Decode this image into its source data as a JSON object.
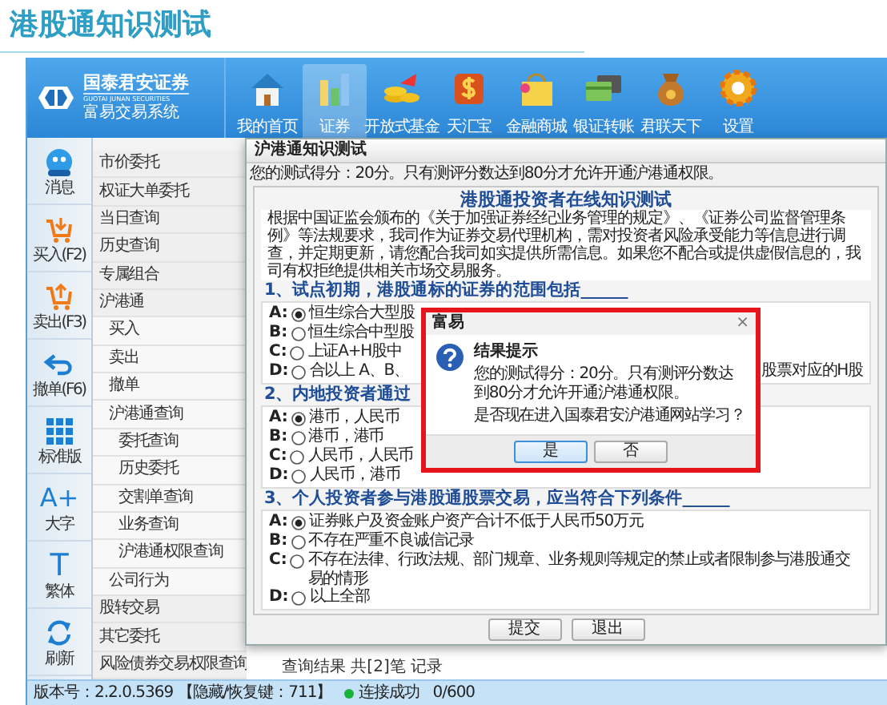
{
  "page_title": "港股通知识测试",
  "app": {
    "logo": {
      "name_cn": "国泰君安证券",
      "name_en": "GUOTAI JUNAN SECURITIES",
      "system": "富易交易系统"
    },
    "nav": [
      {
        "kind": "home",
        "label": "我的首页",
        "selected": false
      },
      {
        "kind": "bars",
        "label": "证券",
        "selected": true
      },
      {
        "kind": "coins",
        "label": "开放式基金",
        "selected": false
      },
      {
        "kind": "dollar",
        "label": "天汇宝",
        "selected": false
      },
      {
        "kind": "bag",
        "label": "金融商城",
        "selected": false
      },
      {
        "kind": "cards",
        "label": "银证转账",
        "selected": false
      },
      {
        "kind": "moneybag",
        "label": "君联天下",
        "selected": false
      },
      {
        "kind": "gear",
        "label": "设置",
        "selected": false
      }
    ]
  },
  "tools": [
    {
      "kind": "chat",
      "label": "消息"
    },
    {
      "kind": "buy",
      "label": "买入(F2)"
    },
    {
      "kind": "sell",
      "label": "卖出(F3)"
    },
    {
      "kind": "undo",
      "label": "撤单(F6)"
    },
    {
      "kind": "grid",
      "label": "标准版"
    },
    {
      "kind": "glyph",
      "glyph": "A+",
      "label": "大字"
    },
    {
      "kind": "glyph",
      "glyph": "T",
      "label": "繁体"
    },
    {
      "kind": "refresh",
      "label": "刷新"
    }
  ],
  "menu": [
    {
      "label": "市价委托"
    },
    {
      "label": "权证大单委托"
    },
    {
      "label": "当日查询"
    },
    {
      "label": "历史查询"
    },
    {
      "label": "专属组合"
    },
    {
      "label": "沪港通",
      "expanded": true,
      "children": [
        {
          "label": "买入"
        },
        {
          "label": "卖出"
        },
        {
          "label": "撤单"
        },
        {
          "label": "沪港通查询",
          "expanded": true,
          "children": [
            {
              "label": "委托查询"
            },
            {
              "label": "历史委托"
            },
            {
              "label": "交割单查询"
            },
            {
              "label": "业务查询"
            },
            {
              "label": "沪港通权限查询"
            }
          ]
        },
        {
          "label": "公司行为"
        }
      ]
    },
    {
      "label": "股转交易"
    },
    {
      "label": "其它委托"
    },
    {
      "label": "风险债券交易权限查询"
    }
  ],
  "dialog": {
    "title": "沪港通知识测试",
    "score_note": "您的测试得分：20分。只有测评分数达到80分才允许开通沪港通权限。",
    "heading": "港股通投资者在线知识测试",
    "intro": "根据中国证监会颁布的《关于加强证券经纪业务管理的规定》、《证券公司监督管理条例》等法规要求，我司作为证券交易代理机构，需对投资者风险承受能力等信息进行调查，并定期更新，请您配合我司如实提供所需信息。如果您不配合或提供虚假信息的，我司有权拒绝提供相关市场交易服务。",
    "questions": [
      {
        "text": "1、试点初期，港股通标的证券的范围包括______",
        "options": [
          {
            "letter": "A:",
            "text": "恒生综合大型股",
            "selected": true
          },
          {
            "letter": "B:",
            "text": "恒生综合中型股",
            "selected": false
          },
          {
            "letter": "C:",
            "text": "上证A+H股中",
            "selected": false
          },
          {
            "letter": "D:",
            "text": "合以上 A、B、",
            "tail": "股票对应的H股",
            "selected": false
          }
        ]
      },
      {
        "text": "2、内地投资者通过",
        "options": [
          {
            "letter": "A:",
            "text": "港币，人民币",
            "selected": true
          },
          {
            "letter": "B:",
            "text": "港币，港币",
            "selected": false
          },
          {
            "letter": "C:",
            "text": "人民币，人民币",
            "selected": false
          },
          {
            "letter": "D:",
            "text": "人民币，港币",
            "selected": false
          }
        ]
      },
      {
        "text": "3、个人投资者参与港股通股票交易，应当符合下列条件______",
        "options": [
          {
            "letter": "A:",
            "text": "证券账户及资金账户资产合计不低于人民币50万元",
            "selected": true
          },
          {
            "letter": "B:",
            "text": "不存在严重不良诚信记录",
            "selected": false
          },
          {
            "letter": "C:",
            "text": "不存在法律、行政法规、部门规章、业务规则等规定的禁止或者限制参与港股通交易的情形",
            "selected": false
          },
          {
            "letter": "D:",
            "text": "以上全部",
            "selected": false
          }
        ]
      }
    ],
    "buttons": [
      "提交",
      "退出"
    ]
  },
  "popup": {
    "title": "富易",
    "close": "×",
    "heading": "结果提示",
    "message": "您的测试得分：20分。只有测评分数达到80分才允许开通沪港通权限。",
    "question": "是否现在进入国泰君安沪港通网站学习？",
    "buttons": [
      {
        "label": "是",
        "selected": true
      },
      {
        "label": "否",
        "selected": false
      }
    ]
  },
  "result_note": "查询结果 共[2]笔 记录",
  "status_bar": {
    "version": "版本号：2.2.0.5369 【隐藏/恢复键：711】",
    "connection": "连接成功",
    "connected": true,
    "count": "0/600"
  }
}
